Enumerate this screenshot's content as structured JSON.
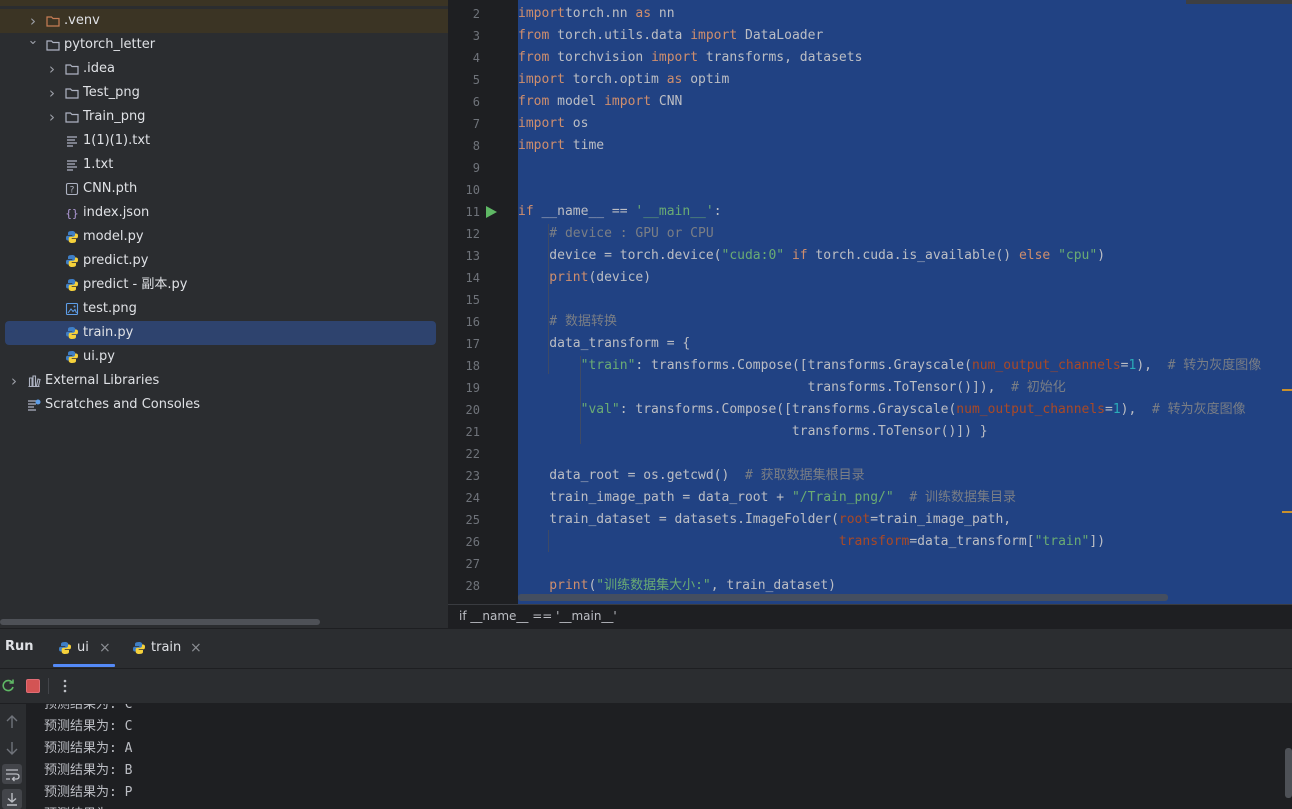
{
  "project_tree": {
    "root_partial": "",
    "items": [
      {
        "label": ".venv",
        "type": "folder-excluded",
        "expanded": false
      },
      {
        "label": "pytorch_letter",
        "type": "folder",
        "expanded": true
      },
      {
        "label": ".idea",
        "type": "folder",
        "expanded": false
      },
      {
        "label": "Test_png",
        "type": "folder",
        "expanded": false
      },
      {
        "label": "Train_png",
        "type": "folder",
        "expanded": false
      },
      {
        "label": "1(1)(1).txt",
        "type": "text-file"
      },
      {
        "label": "1.txt",
        "type": "text-file"
      },
      {
        "label": "CNN.pth",
        "type": "unknown-file"
      },
      {
        "label": "index.json",
        "type": "json-file"
      },
      {
        "label": "model.py",
        "type": "python-file"
      },
      {
        "label": "predict.py",
        "type": "python-file"
      },
      {
        "label": "predict - 副本.py",
        "type": "python-file"
      },
      {
        "label": "test.png",
        "type": "image-file"
      },
      {
        "label": "train.py",
        "type": "python-file",
        "selected": true
      },
      {
        "label": "ui.py",
        "type": "python-file"
      },
      {
        "label": "External Libraries",
        "type": "library",
        "expanded": false
      },
      {
        "label": "Scratches and Consoles",
        "type": "scratches"
      }
    ]
  },
  "editor": {
    "line_numbers": [
      "2",
      "3",
      "4",
      "5",
      "6",
      "7",
      "8",
      "9",
      "10",
      "11",
      "12",
      "13",
      "14",
      "15",
      "16",
      "17",
      "18",
      "19",
      "20",
      "21",
      "22",
      "23",
      "24",
      "25",
      "26",
      "27",
      "28"
    ],
    "lines": [
      [
        [
          "kw",
          "import"
        ],
        [
          "",
          "torch.nn "
        ],
        [
          "kw",
          "as"
        ],
        [
          "",
          " nn"
        ]
      ],
      [
        [
          "kw",
          "from"
        ],
        [
          "",
          " torch.utils.data "
        ],
        [
          "kw",
          "import"
        ],
        [
          "",
          " DataLoader"
        ]
      ],
      [
        [
          "kw",
          "from"
        ],
        [
          "",
          " torchvision "
        ],
        [
          "kw",
          "import"
        ],
        [
          "",
          " transforms, datasets"
        ]
      ],
      [
        [
          "kw",
          "import"
        ],
        [
          "",
          " torch.optim "
        ],
        [
          "kw",
          "as"
        ],
        [
          "",
          " optim"
        ]
      ],
      [
        [
          "kw",
          "from"
        ],
        [
          "",
          " model "
        ],
        [
          "kw",
          "import"
        ],
        [
          "",
          " CNN"
        ]
      ],
      [
        [
          "kw",
          "import"
        ],
        [
          "",
          " os"
        ]
      ],
      [
        [
          "kw",
          "import"
        ],
        [
          "",
          " time"
        ]
      ],
      [],
      [],
      [
        [
          "kw",
          "if"
        ],
        [
          "",
          " __name__ == "
        ],
        [
          "str",
          "'__main__'"
        ],
        [
          "",
          ":"
        ]
      ],
      [
        [
          "cm",
          "    # device : GPU or CPU"
        ]
      ],
      [
        [
          "",
          "    device = torch.device("
        ],
        [
          "str",
          "\"cuda:0\""
        ],
        [
          "kw",
          " if"
        ],
        [
          "",
          " torch.cuda.is_available() "
        ],
        [
          "kw",
          "else"
        ],
        [
          "str",
          " \"cpu\""
        ],
        [
          "",
          ")"
        ]
      ],
      [
        [
          "kw",
          "    print"
        ],
        [
          "",
          "(device)"
        ]
      ],
      [],
      [
        [
          "cm",
          "    # 数据转换"
        ]
      ],
      [
        [
          "",
          "    data_transform = {"
        ]
      ],
      [
        [
          "str",
          "        \"train\""
        ],
        [
          "",
          ": transforms.Compose([transforms.Grayscale("
        ],
        [
          "param",
          "num_output_channels"
        ],
        [
          "",
          "="
        ],
        [
          "num",
          "1"
        ],
        [
          "",
          "),  "
        ],
        [
          "cm",
          "# 转为灰度图像"
        ]
      ],
      [
        [
          "",
          "                                     transforms.ToTensor()]),  "
        ],
        [
          "cm",
          "# 初始化"
        ]
      ],
      [
        [
          "str",
          "        \"val\""
        ],
        [
          "",
          ": transforms.Compose([transforms.Grayscale("
        ],
        [
          "param",
          "num_output_channels"
        ],
        [
          "",
          "="
        ],
        [
          "num",
          "1"
        ],
        [
          "",
          "),  "
        ],
        [
          "cm",
          "# 转为灰度图像"
        ]
      ],
      [
        [
          "",
          "                                   transforms.ToTensor()]) }"
        ]
      ],
      [],
      [
        [
          "",
          "    data_root = os.getcwd()  "
        ],
        [
          "cm",
          "# 获取数据集根目录"
        ]
      ],
      [
        [
          "",
          "    train_image_path = data_root + "
        ],
        [
          "str",
          "\"/Train_png/\""
        ],
        [
          "",
          "  "
        ],
        [
          "cm",
          "# 训练数据集目录"
        ]
      ],
      [
        [
          "",
          "    train_dataset = datasets.ImageFolder("
        ],
        [
          "param",
          "root"
        ],
        [
          "",
          "=train_image_path,"
        ]
      ],
      [
        [
          "",
          "                                         "
        ],
        [
          "param",
          "transform"
        ],
        [
          "",
          "=data_transform["
        ],
        [
          "str",
          "\"train\""
        ],
        [
          "",
          "])"
        ]
      ],
      [],
      [
        [
          "kw",
          "    print"
        ],
        [
          "",
          "("
        ],
        [
          "str",
          "\"训练数据集大小:\""
        ],
        [
          "",
          ", train_dataset)"
        ]
      ]
    ]
  },
  "breadcrumb": {
    "text": "if __name__ == '__main__'"
  },
  "run_panel": {
    "title": "Run",
    "tabs": [
      {
        "label": "ui",
        "active": true
      },
      {
        "label": "train",
        "active": false
      }
    ],
    "close_glyph": "×",
    "output_lines": [
      "预测结果为: C",
      "预测结果为: C",
      "预测结果为: A",
      "预测结果为: B",
      "预测结果为: P",
      "预测结果为: "
    ]
  },
  "colors": {
    "selection": "#214283",
    "accent": "#548af7",
    "keyword": "#cf8e6d",
    "string": "#6aab73",
    "comment": "#7a7e85"
  }
}
